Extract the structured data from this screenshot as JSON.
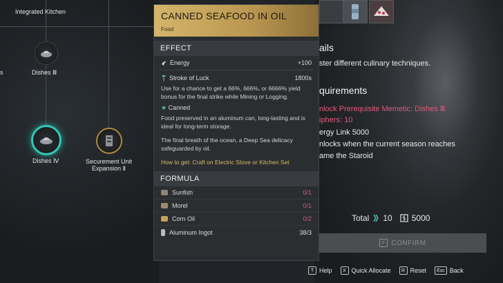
{
  "tree": {
    "node_integrated": "Integrated Kitchen",
    "node_dishes3": "Dishes Ⅲ",
    "node_dishes4": "Dishes Ⅳ",
    "node_securement_line1": "Securement Unit",
    "node_securement_line2": "Expansion Ⅱ",
    "left_edge_fragment": "s"
  },
  "panel": {
    "title": "CANNED SEAFOOD IN OIL",
    "category": "Food",
    "effect_header": "EFFECT",
    "energy_label": "Energy",
    "energy_value": "+100",
    "luck_label": "Stroke of Luck",
    "luck_value": "1800s",
    "luck_desc": "Use for a chance to get a 66%, 666%, or 6666% yield bonus for the final strike while Mining or Logging.",
    "canned_label": "Canned",
    "canned_desc": "Food preserved in an aluminum can, long-lasting and is ideal for long-term storage.",
    "flavor": "The final breath of the ocean, a Deep Sea delicacy safeguarded by oil.",
    "how_to_get": "How to get: Craft on Electric Stove or Kitchen Set",
    "formula_header": "FORMULA",
    "formula": [
      {
        "name": "Sunfish",
        "qty": "0/1",
        "ok": false
      },
      {
        "name": "Morel",
        "qty": "0/1",
        "ok": false
      },
      {
        "name": "Corn Oil",
        "qty": "0/2",
        "ok": false
      },
      {
        "name": "Aluminum Ingot",
        "qty": "38/3",
        "ok": true
      }
    ]
  },
  "details": {
    "title_fragment": "ails",
    "desc_fragment": "ster different culinary techniques.",
    "req_header_fragment": "quirements",
    "req_prereq": "nlock Prerequisite Memetic: Dishes Ⅲ",
    "req_ciphers": "iphers:  10",
    "req_energy": "ergy Link 5000",
    "req_season1": "nlocks when the current season reaches",
    "req_season2": "ame the Staroid",
    "total_label": "Total",
    "total_ciphers": "10",
    "total_energy": "5000",
    "confirm_key": "F",
    "confirm_label": "CONFIRM"
  },
  "hints": [
    {
      "key": "T",
      "label": "Help"
    },
    {
      "key": "X",
      "label": "Quick Allocate"
    },
    {
      "key": "R",
      "label": "Reset"
    },
    {
      "key": "Esc",
      "label": "Back"
    }
  ],
  "colors": {
    "accent_teal": "#2fc9b6",
    "gold": "#d4b56a",
    "missing_red": "#d9566f",
    "req_pink": "#e2587a"
  }
}
